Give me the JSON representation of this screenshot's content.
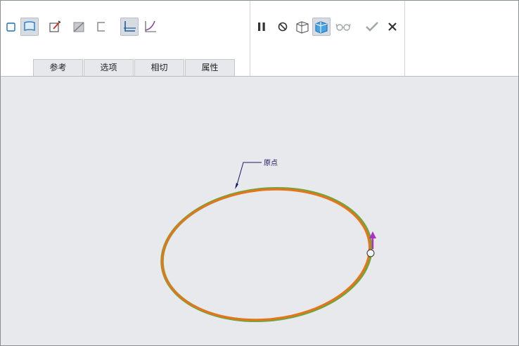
{
  "tabs": [
    {
      "label": "参考"
    },
    {
      "label": "选项"
    },
    {
      "label": "相切"
    },
    {
      "label": "属性"
    }
  ],
  "toolbar": {
    "left_tools": [
      "solid-icon",
      "surface-icon",
      "edit-sketch-icon",
      "remove-material-icon",
      "thicken-icon",
      "normal-section-icon",
      "curve-icon"
    ],
    "right_tools": [
      "pause-icon",
      "no-preview-icon",
      "verify-icon",
      "preview-icon",
      "glasses-icon",
      "confirm-icon",
      "cancel-icon"
    ]
  },
  "canvas": {
    "origin_label": "原点",
    "curve_color": "#e8731a",
    "curve_edge_color": "#6fa53a",
    "arrow_color": "#b02fc4",
    "background": "#e8e9ec"
  }
}
